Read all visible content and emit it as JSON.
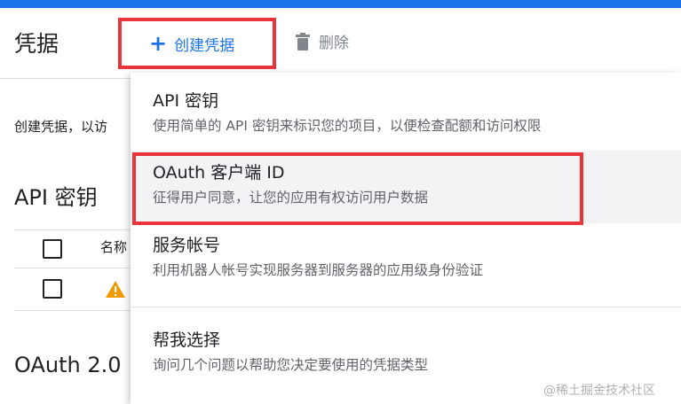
{
  "page": {
    "title": "凭据"
  },
  "toolbar": {
    "create_label": "创建凭据",
    "delete_label": "删除"
  },
  "content": {
    "intro_text": "创建凭据，以访",
    "api_keys_title": "API 密钥",
    "api_table": {
      "column_name": "名称"
    },
    "oauth_title": "OAuth 2.0"
  },
  "dropdown": {
    "items": [
      {
        "title": "API 密钥",
        "description": "使用简单的 API 密钥来标识您的项目，以便检查配额和访问权限"
      },
      {
        "title": "OAuth 客户端 ID",
        "description": "征得用户同意，让您的应用有权访问用户数据"
      },
      {
        "title": "服务帐号",
        "description": "利用机器人帐号实现服务器到服务器的应用级身份验证"
      },
      {
        "title": "帮我选择",
        "description": "询问几个问题以帮助您决定要使用的凭据类型"
      }
    ]
  },
  "watermark": "@稀土掘金技术社区",
  "colors": {
    "accent": "#1a73e8",
    "highlight": "#ea333a",
    "warning": "#f29900"
  }
}
